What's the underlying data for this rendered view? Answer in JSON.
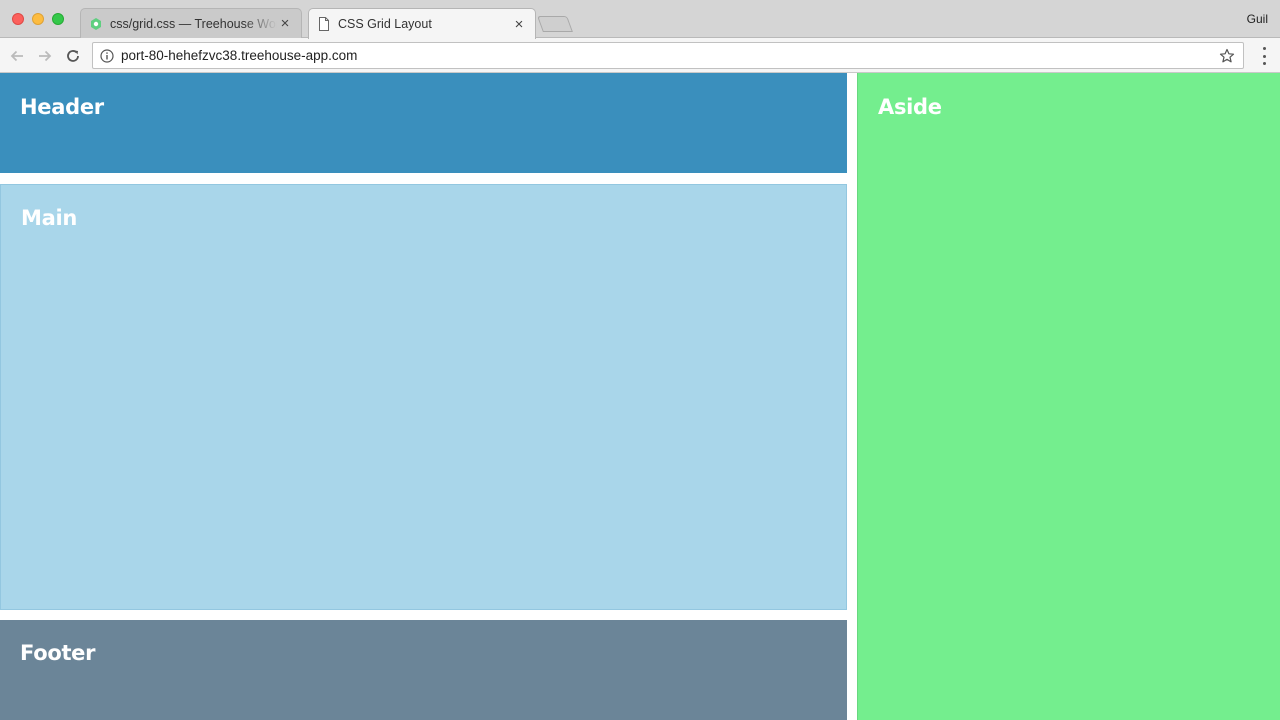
{
  "browser": {
    "tabs": [
      {
        "title": "css/grid.css — Treehouse Workspaces",
        "active": false,
        "favicon": "treehouse-icon"
      },
      {
        "title": "CSS Grid Layout",
        "active": true,
        "favicon": "document-icon"
      }
    ],
    "profile_name": "Guil",
    "url": "port-80-hehefzvc38.treehouse-app.com"
  },
  "page": {
    "header_label": "Header",
    "main_label": "Main",
    "aside_label": "Aside",
    "footer_label": "Footer"
  },
  "colors": {
    "header": "#3a8fbd",
    "main": "#a9d6ea",
    "aside": "#74ee8e",
    "footer": "#6b8598"
  }
}
